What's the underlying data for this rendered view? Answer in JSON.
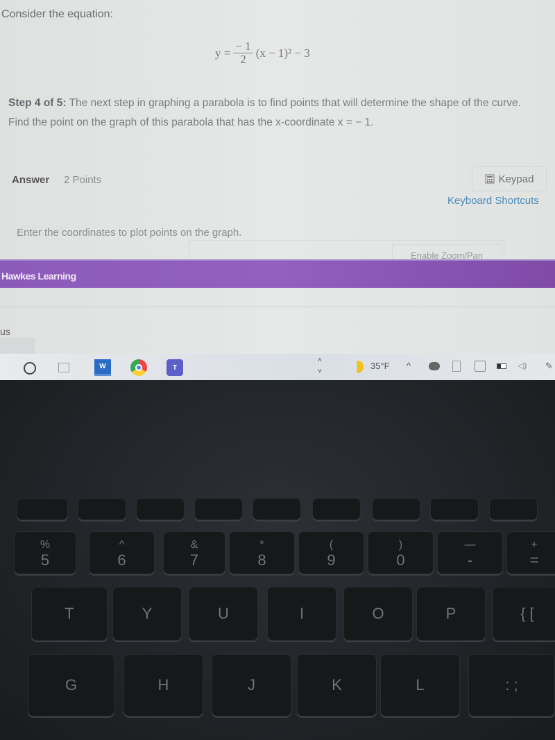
{
  "question": {
    "intro": "Consider the equation:",
    "equation": {
      "lhs": "y =",
      "numerator": "− 1",
      "denominator": "2",
      "rest": "(x − 1)² − 3"
    },
    "step_label": "Step 4 of 5:",
    "step_text": " The next step in graphing a parabola is to find points that will determine the shape of the curve. Find the point on the graph of this parabola that has the x-coordinate x = − 1."
  },
  "answer": {
    "label": "Answer",
    "points": "2 Points",
    "keypad_label": "Keypad",
    "keypad_icon": "calculator-icon",
    "shortcuts_link": "Keyboard Shortcuts",
    "instruction": "Enter the coordinates to plot points on the graph.",
    "zoom_pan_button": "Enable Zoom/Pan"
  },
  "footer": {
    "brand": "Hawkes Learning",
    "brand_color": "#8c5ab8",
    "partial_text": "us"
  },
  "taskbar": {
    "icons": [
      "cortana-circle-icon",
      "task-view-icon",
      "word-icon",
      "chrome-icon",
      "teams-icon"
    ],
    "weather_temp": "35°F",
    "tray_icons": [
      "chevron-up-icon",
      "onedrive-icon",
      "meet-icon",
      "network-icon",
      "battery-icon",
      "volume-icon",
      "pen-icon"
    ]
  },
  "keyboard": {
    "number_row": [
      {
        "top": "%",
        "bottom": "5"
      },
      {
        "top": "^",
        "bottom": "6"
      },
      {
        "top": "&",
        "bottom": "7"
      },
      {
        "top": "*",
        "bottom": "8"
      },
      {
        "top": "(",
        "bottom": "9"
      },
      {
        "top": ")",
        "bottom": "0"
      },
      {
        "top": "—",
        "bottom": "-"
      },
      {
        "top": "+",
        "bottom": "="
      }
    ],
    "letter_row1": [
      "T",
      "Y",
      "U",
      "I",
      "O",
      "P",
      "{ ["
    ],
    "letter_row2": [
      "G",
      "H",
      "J",
      "K",
      "L",
      ": ;"
    ]
  }
}
